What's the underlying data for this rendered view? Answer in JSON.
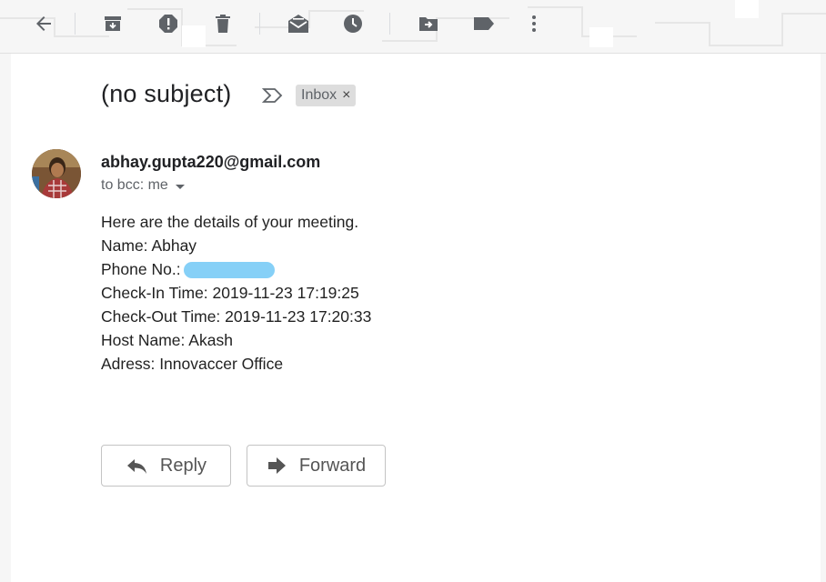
{
  "toolbar": {
    "back": "arrow-back-icon",
    "archive": "archive-icon",
    "spam": "report-spam-icon",
    "delete": "delete-icon",
    "mark_unread": "mark-unread-icon",
    "snooze": "snooze-icon",
    "move": "move-to-icon",
    "label": "label-icon",
    "more": "more-vert-icon"
  },
  "email": {
    "subject": "(no subject)",
    "label": "Inbox",
    "label_remove": "×",
    "sender": "abhay.gupta220@gmail.com",
    "recipients": "to bcc: me",
    "body": {
      "line1": "Here are the details of your meeting.",
      "line2": "Name: Abhay",
      "line3_label": "Phone No.:",
      "line4": "Check-In Time: 2019-11-23 17:19:25",
      "line5": "Check-Out Time: 2019-11-23 17:20:33",
      "line6": "Host Name: Akash",
      "line7": "Adress: Innovaccer Office"
    }
  },
  "actions": {
    "reply": "Reply",
    "forward": "Forward"
  },
  "colors": {
    "icon": "#5f6368",
    "redaction": "#86d0f7",
    "chip_bg": "#dddddd"
  }
}
